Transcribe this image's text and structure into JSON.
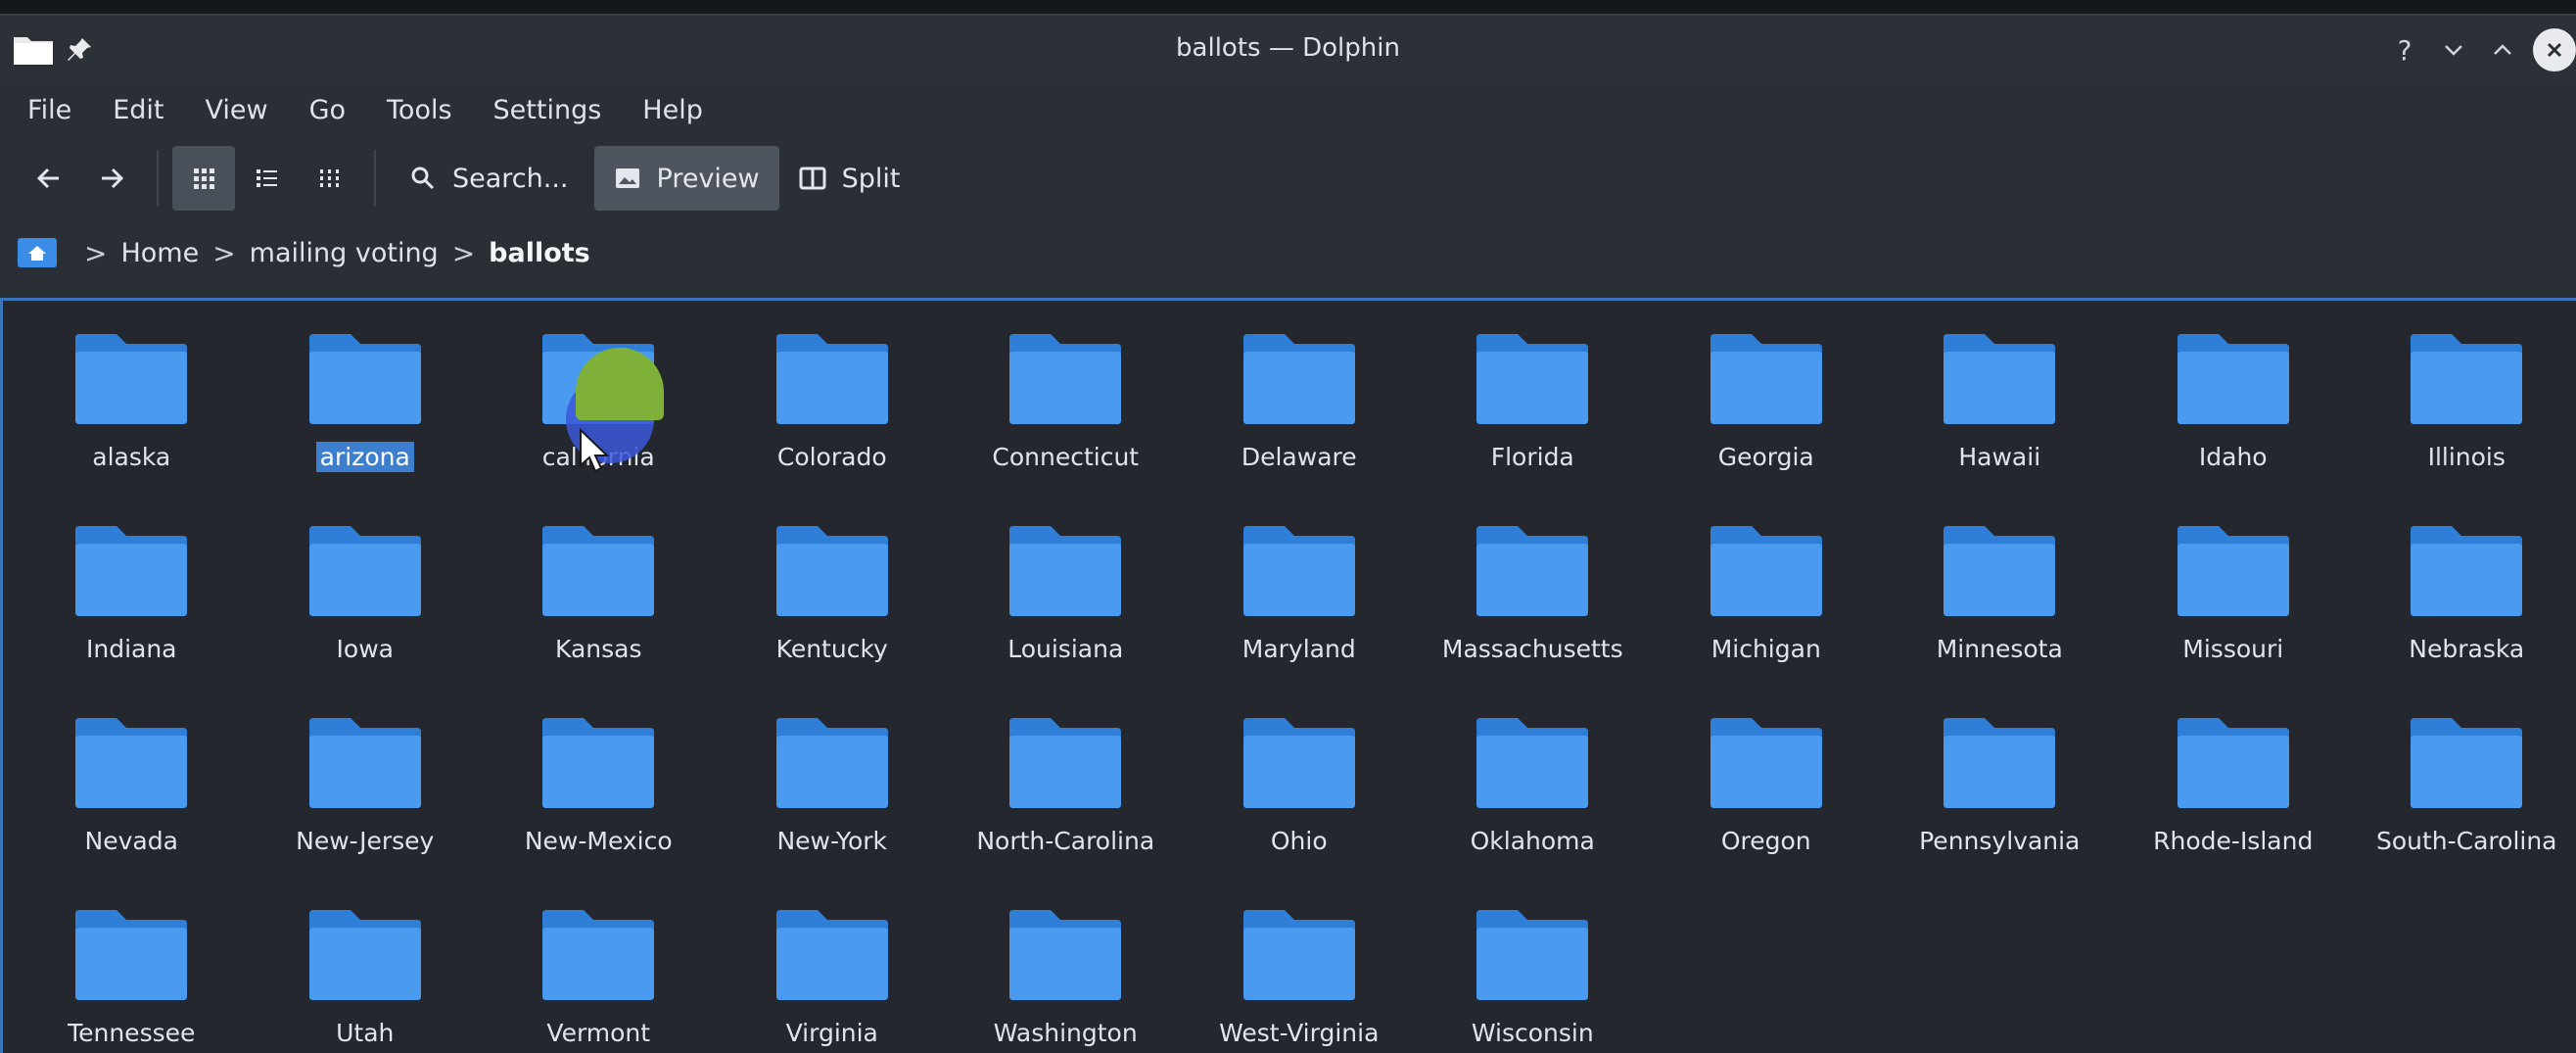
{
  "window": {
    "title": "ballots — Dolphin",
    "controls": [
      "?",
      "⌄",
      "⌃",
      "✕"
    ]
  },
  "menu": [
    "File",
    "Edit",
    "View",
    "Go",
    "Tools",
    "Settings",
    "Help"
  ],
  "toolbar": {
    "search_label": "Search...",
    "preview_label": "Preview",
    "split_label": "Split"
  },
  "breadcrumb": {
    "items": [
      "Home",
      "mailing voting"
    ],
    "current": "ballots"
  },
  "accent_color": "#3b8ce6",
  "folders": [
    "alaska",
    "arizona",
    "california",
    "Colorado",
    "Connecticut",
    "Delaware",
    "Florida",
    "Georgia",
    "Hawaii",
    "Idaho",
    "Illinois",
    "Indiana",
    "Iowa",
    "Kansas",
    "Kentucky",
    "Louisiana",
    "Maryland",
    "Massachusetts",
    "Michigan",
    "Minnesota",
    "Missouri",
    "Nebraska",
    "Nevada",
    "New-Jersey",
    "New-Mexico",
    "New-York",
    "North-Carolina",
    "Ohio",
    "Oklahoma",
    "Oregon",
    "Pennsylvania",
    "Rhode-Island",
    "South-Carolina",
    "Tennessee",
    "Utah",
    "Vermont",
    "Virginia",
    "Washington",
    "West-Virginia",
    "Wisconsin"
  ],
  "selected_folder": "arizona",
  "hovered_folder": "california"
}
